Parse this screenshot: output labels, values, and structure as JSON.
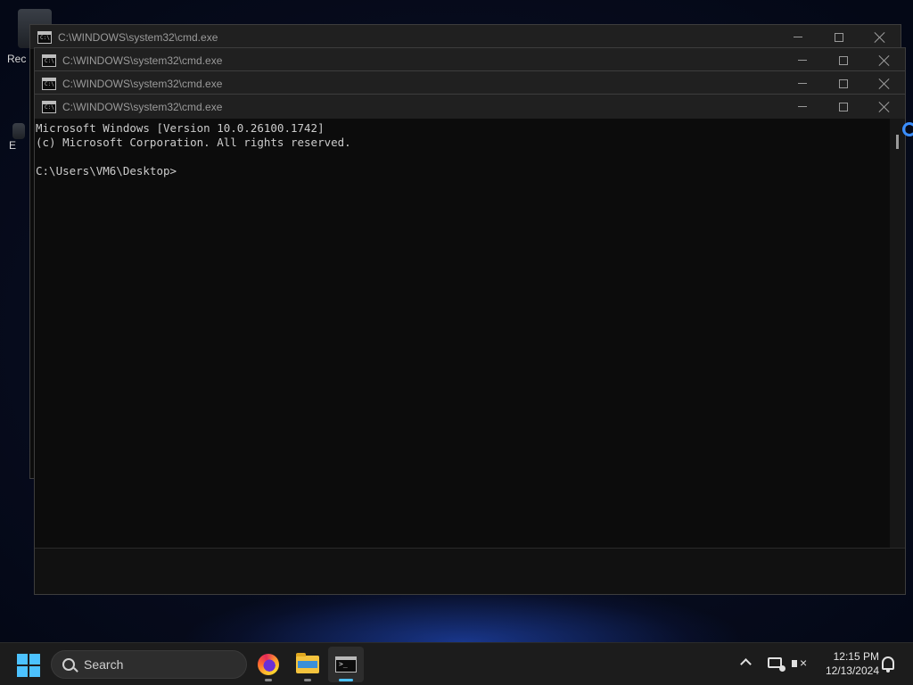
{
  "desktop": {
    "icons": [
      {
        "label": "Rec"
      },
      {
        "label": "E"
      }
    ]
  },
  "windows": [
    {
      "title": "C:\\WINDOWS\\system32\\cmd.exe"
    },
    {
      "title": "C:\\WINDOWS\\system32\\cmd.exe"
    },
    {
      "title": "C:\\WINDOWS\\system32\\cmd.exe"
    },
    {
      "title": "C:\\WINDOWS\\system32\\cmd.exe"
    }
  ],
  "console": {
    "lines": "Microsoft Windows [Version 10.0.26100.1742]\n(c) Microsoft Corporation. All rights reserved.\n\nC:\\Users\\VM6\\Desktop>"
  },
  "window_controls": {
    "minimize": "minimize-icon",
    "maximize": "maximize-icon",
    "close": "close-icon"
  },
  "taskbar": {
    "search_label": "Search",
    "apps": [
      {
        "icon": "firefox-icon",
        "active": false
      },
      {
        "icon": "file-explorer-icon",
        "active": false
      },
      {
        "icon": "command-prompt-icon",
        "active": true
      }
    ],
    "accent_color": "#4cc2ff",
    "clock": {
      "time": "12:15 PM",
      "date": "12/13/2024"
    }
  }
}
